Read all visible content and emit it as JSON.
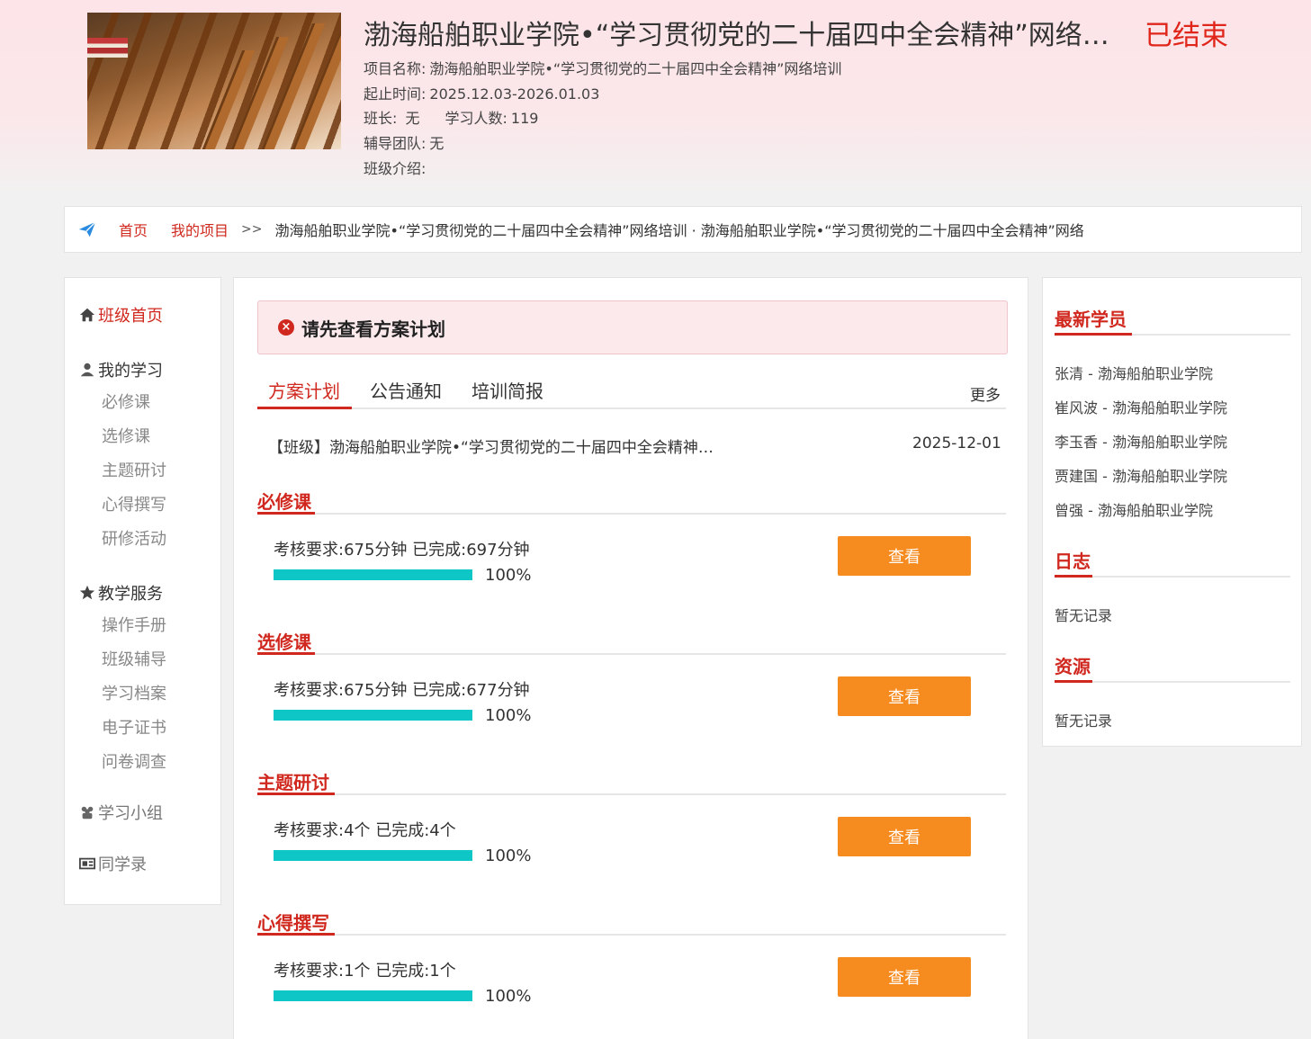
{
  "header": {
    "title": "渤海船舶职业学院•“学习贯彻党的二十届四中全会精神”网络培训",
    "status": "已结束",
    "project_name_label": "项目名称:",
    "project_name": "渤海船舶职业学院•“学习贯彻党的二十届四中全会精神”网络培训",
    "period_label": "起止时间:",
    "period": "2025.12.03-2026.01.03",
    "monitor_label": "班长:",
    "monitor": "无",
    "students_label": "学习人数:",
    "students": "119",
    "team_label": "辅导团队:",
    "team": "无",
    "intro_label": "班级介绍:",
    "intro": ""
  },
  "breadcrumb": {
    "home": "首页",
    "my_projects": "我的项目",
    "sep": ">>",
    "current": "渤海船舶职业学院•“学习贯彻党的二十届四中全会精神”网络培训 · 渤海船舶职业学院•“学习贯彻党的二十届四中全会精神”网络"
  },
  "leftnav": {
    "home": "班级首页",
    "my_study": "我的学习",
    "study_items": [
      "必修课",
      "选修课",
      "主题研讨",
      "心得撰写",
      "研修活动"
    ],
    "teaching": "教学服务",
    "teaching_items": [
      "操作手册",
      "班级辅导",
      "学习档案",
      "电子证书",
      "问卷调查"
    ],
    "group": "学习小组",
    "classmates": "同学录"
  },
  "main": {
    "alert": "请先查看方案计划",
    "tabs": [
      "方案计划",
      "公告通知",
      "培训简报"
    ],
    "more": "更多",
    "notice_title": "【班级】渤海船舶职业学院•“学习贯彻党的二十届四中全会精神”网络培训方案",
    "notice_date": "2025-12-01",
    "sections": [
      {
        "title": "必修课",
        "req": "考核要求:675分钟 已完成:697分钟",
        "progress": 100,
        "pct": "100%",
        "btn": "查看"
      },
      {
        "title": "选修课",
        "req": "考核要求:675分钟 已完成:677分钟",
        "progress": 100,
        "pct": "100%",
        "btn": "查看"
      },
      {
        "title": "主题研讨",
        "req": "考核要求:4个 已完成:4个",
        "progress": 100,
        "pct": "100%",
        "btn": "查看"
      },
      {
        "title": "心得撰写",
        "req": "考核要求:1个 已完成:1个",
        "progress": 100,
        "pct": "100%",
        "btn": "查看"
      }
    ]
  },
  "right": {
    "latest_title": "最新学员",
    "students": [
      "张清 - 渤海船舶职业学院",
      "崔风波 - 渤海船舶职业学院",
      "李玉香 - 渤海船舶职业学院",
      "贾建国 - 渤海船舶职业学院",
      "曾强 - 渤海船舶职业学院"
    ],
    "log_title": "日志",
    "log_empty": "暂无记录",
    "res_title": "资源",
    "res_empty": "暂无记录"
  },
  "colors": {
    "accent": "#d0281e",
    "button": "#f68b1f",
    "progress": "#0fc6c6"
  }
}
